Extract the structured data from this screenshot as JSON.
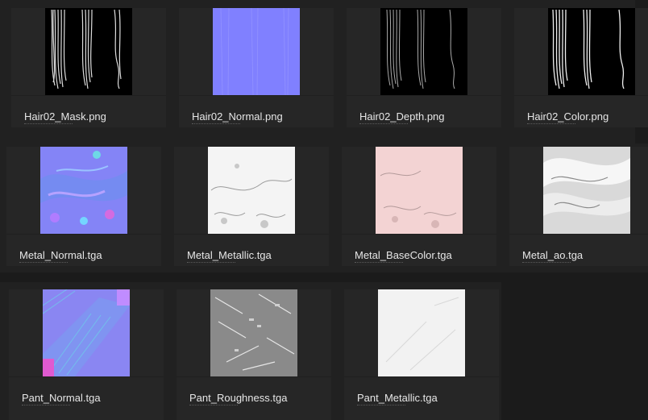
{
  "files": [
    {
      "label": "Hair02_Mask.png",
      "icon": "hair-mask-thumbnail"
    },
    {
      "label": "Hair02_Normal.png",
      "icon": "normal-map-thumbnail"
    },
    {
      "label": "Hair02_Depth.png",
      "icon": "hair-depth-thumbnail"
    },
    {
      "label": "Hair02_Color.png",
      "icon": "hair-color-thumbnail"
    },
    {
      "label": "Metal_Normal.tga",
      "icon": "normal-map-thumbnail"
    },
    {
      "label": "Metal_Metallic.tga",
      "icon": "metallic-map-thumbnail"
    },
    {
      "label": "Metal_BaseColor.tga",
      "icon": "basecolor-map-thumbnail"
    },
    {
      "label": "Metal_ao.tga",
      "icon": "ao-map-thumbnail"
    },
    {
      "label": "Pant_Normal.tga",
      "icon": "normal-map-thumbnail"
    },
    {
      "label": "Pant_Roughness.tga",
      "icon": "roughness-map-thumbnail"
    },
    {
      "label": "Pant_Metallic.tga",
      "icon": "metallic-map-thumbnail"
    }
  ],
  "colors": {
    "background": "#1b1b1b",
    "card": "#262626",
    "label": "#e6e6e6",
    "normal_blue": "#8080ff",
    "basecolor_pink": "#f3d3d3"
  }
}
